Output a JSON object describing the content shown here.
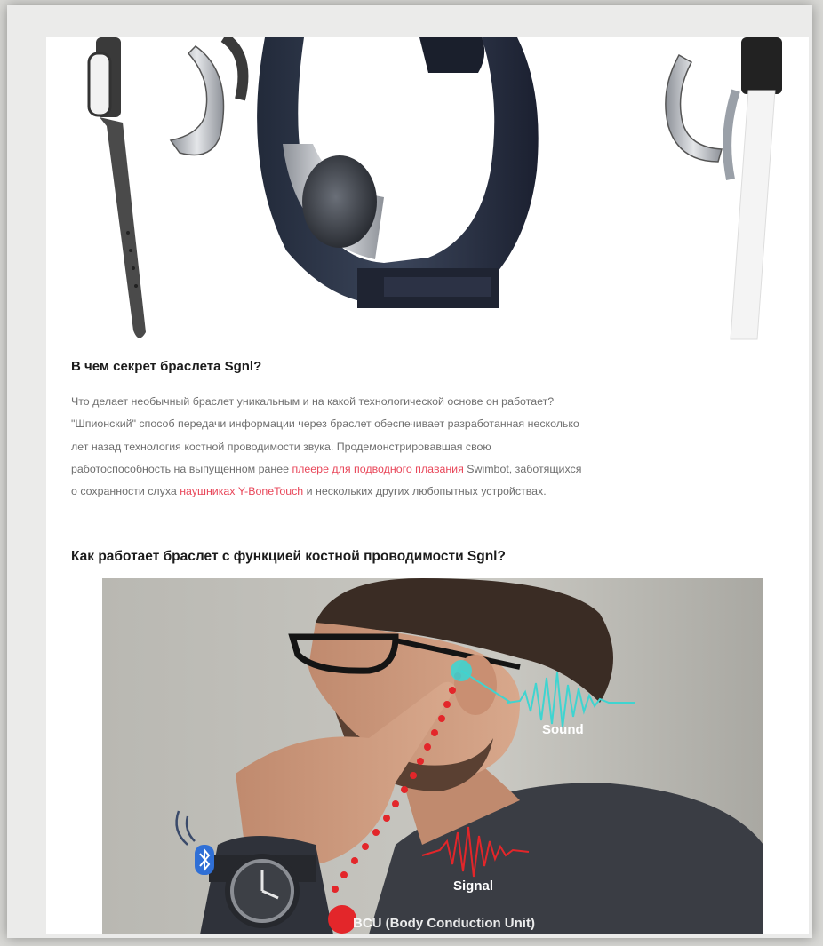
{
  "article": {
    "heading_1": "В чем секрет браслета Sgnl?",
    "paragraph": {
      "line_1": "Что делает необычный браслет уникальным и на какой технологической основе он работает?",
      "line_2": "\"Шпионский\" способ передачи информации через браслет обеспечивает разработанная несколько",
      "line_3": "лет назад технология костной проводимости звука. Продемонстрировавшая свою",
      "line_4_before": "работоспособность на выпущенном ранее ",
      "link_1": "плеере для подводного плавания",
      "line_4_after": " Swimbot, заботящихся",
      "line_5_before": "о сохранности слуха ",
      "link_2": "наушниках Y-BoneTouch",
      "line_5_after": " и нескольких других любопытных устройствах."
    },
    "heading_2": "Как работает браслет с функцией костной проводимости Sgnl?"
  },
  "illustration": {
    "sound_label": "Sound",
    "signal_label": "Signal",
    "bcu_label": "BCU (Body Conduction Unit)",
    "colors": {
      "sound_wave": "#3fd4d0",
      "signal_wave": "#e3262a",
      "bluetooth": "#2f6fd6"
    }
  },
  "icons": [
    "bluetooth-icon",
    "wireless-signal-icon"
  ]
}
